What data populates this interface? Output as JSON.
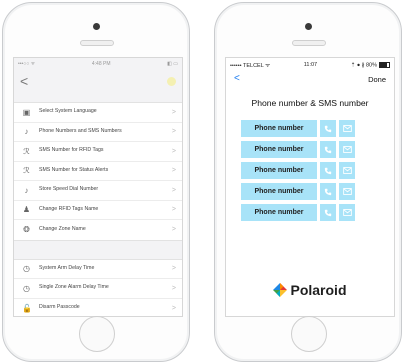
{
  "left_screen": {
    "status": {
      "carrier": "•••○○ ᯤ",
      "time": "4:48 PM",
      "battery": "◧ ▭"
    },
    "nav": {
      "back": "<"
    },
    "menu_group_1": [
      {
        "label": "Select System Language",
        "icon": "language-icon",
        "glyph": "▣"
      },
      {
        "label": "Phone Numbers and SMS Numbers",
        "icon": "phone-user-icon",
        "glyph": "♪"
      },
      {
        "label": "SMS Number for RFID Tags",
        "icon": "rfid-icon",
        "glyph": "ℛ"
      },
      {
        "label": "SMS Number for Status Alerts",
        "icon": "alert-icon",
        "glyph": "ℛ"
      },
      {
        "label": "Store Speed Dial Number",
        "icon": "speed-dial-icon",
        "glyph": "♪"
      },
      {
        "label": "Change RFID Tags Name",
        "icon": "person-icon",
        "glyph": "♟"
      },
      {
        "label": "Change Zone Name",
        "icon": "zone-icon",
        "glyph": "❂"
      }
    ],
    "menu_group_2": [
      {
        "label": "System Arm Delay Time",
        "icon": "clock-icon",
        "glyph": "◷"
      },
      {
        "label": "Single Zone Alarm Delay Time",
        "icon": "clock-icon",
        "glyph": "◷"
      },
      {
        "label": "Disarm Passcode",
        "icon": "lock-icon",
        "glyph": "🔓"
      }
    ],
    "chevron": ">"
  },
  "right_screen": {
    "status": {
      "carrier": "•••••• TELCEL ᯤ",
      "time": "11:07",
      "battery_text": "⇡ ● ∦ 80%"
    },
    "nav": {
      "back": "<",
      "done": "Done"
    },
    "title": "Phone number & SMS number",
    "rows": [
      {
        "label": "Phone number"
      },
      {
        "label": "Phone number"
      },
      {
        "label": "Phone number"
      },
      {
        "label": "Phone number"
      },
      {
        "label": "Phone number"
      }
    ],
    "logo": "Polaroid"
  },
  "colors": {
    "accent_blue": "#1c7cf0",
    "button_fill": "#a8e3f8"
  }
}
